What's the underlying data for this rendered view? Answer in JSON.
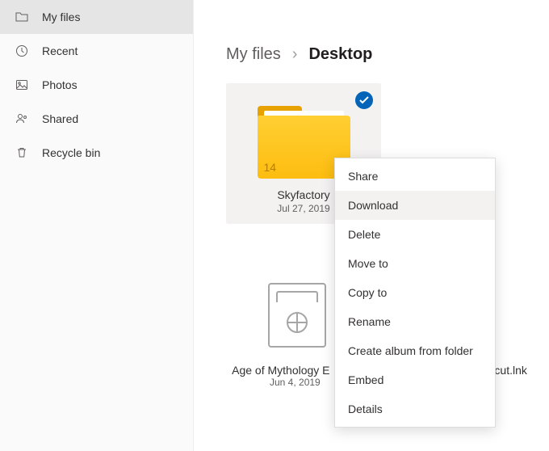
{
  "sidebar": {
    "items": [
      {
        "label": "My files"
      },
      {
        "label": "Recent"
      },
      {
        "label": "Photos"
      },
      {
        "label": "Shared"
      },
      {
        "label": "Recycle bin"
      }
    ]
  },
  "breadcrumb": {
    "parent": "My files",
    "current": "Desktop"
  },
  "tiles": [
    {
      "name": "Skyfactory",
      "date": "Jul 27, 2019",
      "count": "14"
    }
  ],
  "tile2": {
    "name_left": "Age of Mythology E",
    "name_right": "tcut.lnk",
    "date": "Jun 4, 2019"
  },
  "context_menu": {
    "items": [
      "Share",
      "Download",
      "Delete",
      "Move to",
      "Copy to",
      "Rename",
      "Create album from folder",
      "Embed",
      "Details"
    ]
  }
}
